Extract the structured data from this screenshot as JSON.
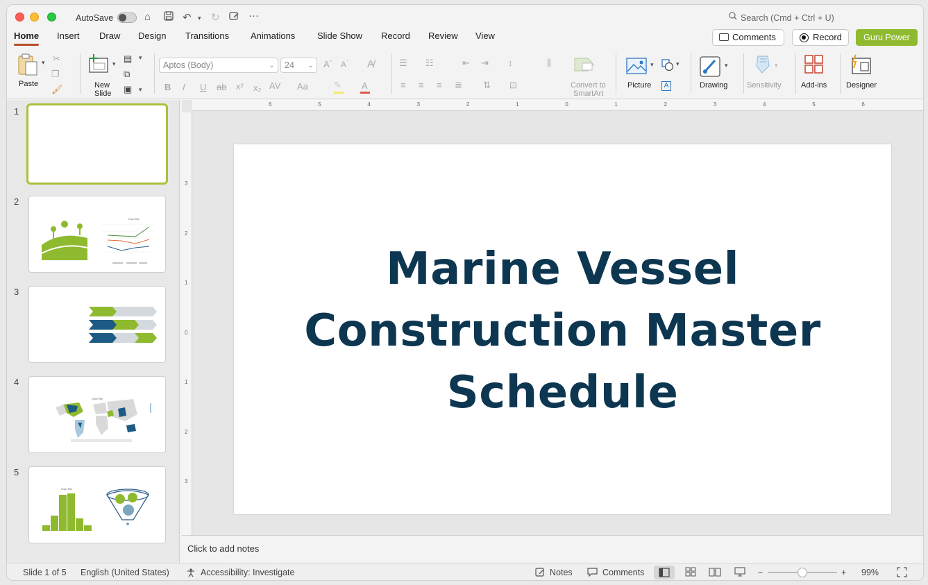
{
  "titlebar": {
    "autosave_label": "AutoSave",
    "search_placeholder": "Search (Cmd + Ctrl + U)"
  },
  "tabs": [
    "Home",
    "Insert",
    "Draw",
    "Design",
    "Transitions",
    "Animations",
    "Slide Show",
    "Record",
    "Review",
    "View"
  ],
  "header_buttons": {
    "comments": "Comments",
    "record": "Record",
    "guru": "Guru Power"
  },
  "ribbon": {
    "paste": "Paste",
    "new_slide_1": "New",
    "new_slide_2": "Slide",
    "font_name": "Aptos (Body)",
    "font_size": "24",
    "convert_1": "Convert to",
    "convert_2": "SmartArt",
    "picture": "Picture",
    "drawing": "Drawing",
    "sensitivity": "Sensitivity",
    "addins": "Add-ins",
    "designer": "Designer"
  },
  "slides": [
    {
      "num": "1"
    },
    {
      "num": "2"
    },
    {
      "num": "3"
    },
    {
      "num": "4"
    },
    {
      "num": "5"
    }
  ],
  "slide_title": [
    "Marine Vessel",
    "Construction Master",
    "Schedule"
  ],
  "notes_placeholder": "Click to add notes",
  "ruler_h": [
    "6",
    "5",
    "4",
    "3",
    "2",
    "1",
    "0",
    "1",
    "2",
    "3",
    "4",
    "5",
    "6"
  ],
  "ruler_v": [
    "3",
    "2",
    "1",
    "0",
    "1",
    "2",
    "3"
  ],
  "status": {
    "slide_info": "Slide 1 of 5",
    "language": "English (United States)",
    "accessibility": "Accessibility: Investigate",
    "notes": "Notes",
    "comments": "Comments",
    "zoom": "99%",
    "zoom_level": 0.5
  },
  "colors": {
    "accent_green": "#8fba2f",
    "title_color": "#0d3651",
    "tab_underline": "#b84b29"
  }
}
